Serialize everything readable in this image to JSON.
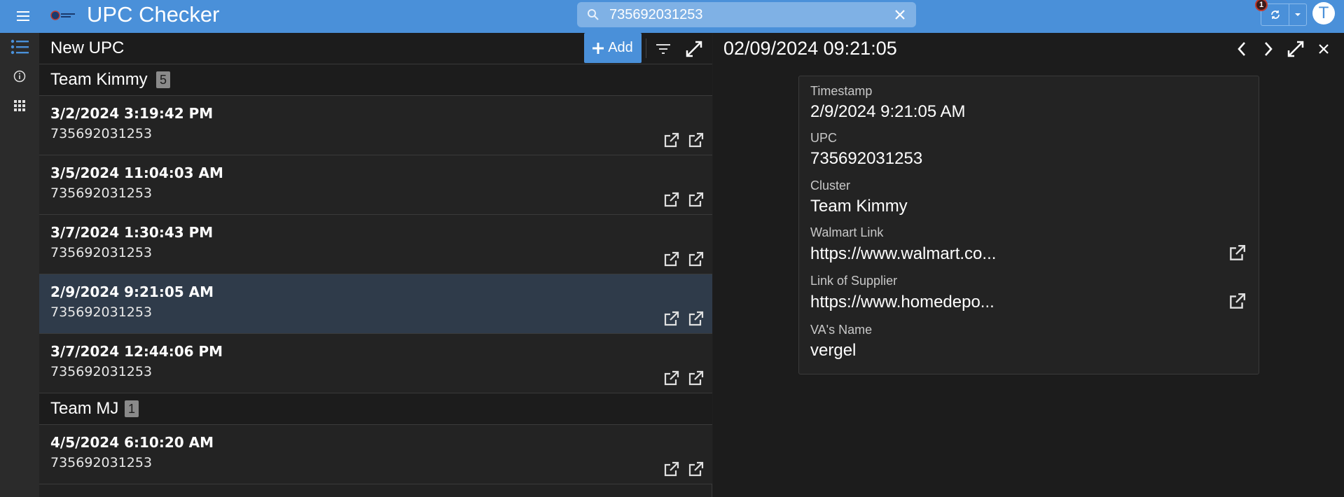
{
  "app": {
    "title": "UPC Checker",
    "accent": "#4a90d9",
    "alert_count": "1",
    "user_initial": "T"
  },
  "search": {
    "value": "735692031253",
    "placeholder": "Search"
  },
  "list": {
    "title": "New UPC",
    "add_label": "Add",
    "groups": [
      {
        "name": "Team Kimmy",
        "count": "5",
        "rows": [
          {
            "date": "3/2/2024 3:19:42 PM",
            "upc": "735692031253"
          },
          {
            "date": "3/5/2024 11:04:03 AM",
            "upc": "735692031253"
          },
          {
            "date": "3/7/2024 1:30:43 PM",
            "upc": "735692031253"
          },
          {
            "date": "2/9/2024 9:21:05 AM",
            "upc": "735692031253"
          },
          {
            "date": "3/7/2024 12:44:06 PM",
            "upc": "735692031253"
          }
        ]
      },
      {
        "name": "Team MJ",
        "count": "1",
        "rows": [
          {
            "date": "4/5/2024 6:10:20 AM",
            "upc": "735692031253"
          }
        ]
      }
    ]
  },
  "detail": {
    "title": "02/09/2024 09:21:05",
    "fields": [
      {
        "label": "Timestamp",
        "value": "2/9/2024 9:21:05 AM"
      },
      {
        "label": "UPC",
        "value": "735692031253"
      },
      {
        "label": "Cluster",
        "value": "Team Kimmy"
      },
      {
        "label": "Walmart Link",
        "value": "https://www.walmart.co..."
      },
      {
        "label": "Link of Supplier",
        "value": "https://www.homedepo..."
      },
      {
        "label": "VA's Name",
        "value": "vergel"
      }
    ]
  }
}
